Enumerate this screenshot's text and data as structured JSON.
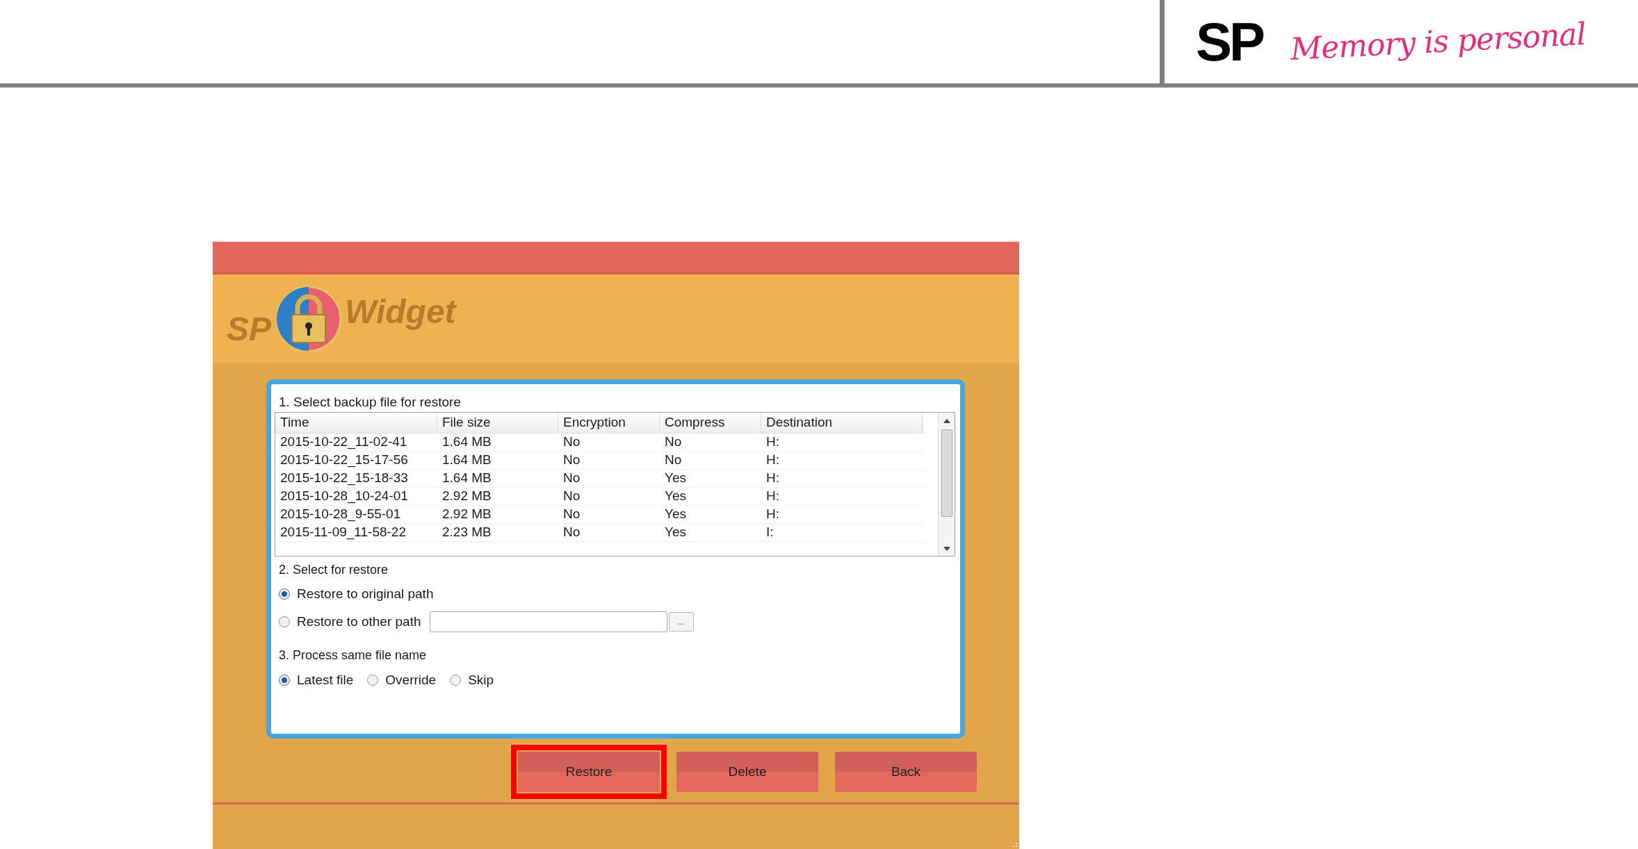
{
  "header": {
    "logo": "SP",
    "tagline": "Memory is personal"
  },
  "app": {
    "brand": [
      "SP",
      "Widget"
    ],
    "section_1": {
      "title": "1. Select backup file for restore",
      "columns": [
        "Time",
        "File size",
        "Encryption",
        "Compress",
        "Destination"
      ],
      "rows": [
        [
          "2015-10-22_11-02-41",
          "1.64 MB",
          "No",
          "No",
          "H:"
        ],
        [
          "2015-10-22_15-17-56",
          "1.64 MB",
          "No",
          "No",
          "H:"
        ],
        [
          "2015-10-22_15-18-33",
          "1.64 MB",
          "No",
          "Yes",
          "H:"
        ],
        [
          "2015-10-28_10-24-01",
          "2.92 MB",
          "No",
          "Yes",
          "H:"
        ],
        [
          "2015-10-28_9-55-01",
          "2.92 MB",
          "No",
          "Yes",
          "H:"
        ],
        [
          "2015-11-09_11-58-22",
          "2.23 MB",
          "No",
          "Yes",
          "I:"
        ]
      ]
    },
    "section_2": {
      "title": "2. Select for restore",
      "options": [
        {
          "label": "Restore to original path",
          "selected": true,
          "kind": "plain"
        },
        {
          "label": "Restore to other path",
          "selected": false,
          "kind": "path"
        }
      ],
      "browse": "..."
    },
    "section_3": {
      "title": "3. Process same file name",
      "options": [
        {
          "label": "Latest file",
          "selected": true
        },
        {
          "label": "Override",
          "selected": false
        },
        {
          "label": "Skip",
          "selected": false
        }
      ]
    },
    "buttons": [
      {
        "label": "Restore",
        "highlighted": true
      },
      {
        "label": "Delete",
        "highlighted": false
      },
      {
        "label": "Back",
        "highlighted": false
      }
    ]
  }
}
